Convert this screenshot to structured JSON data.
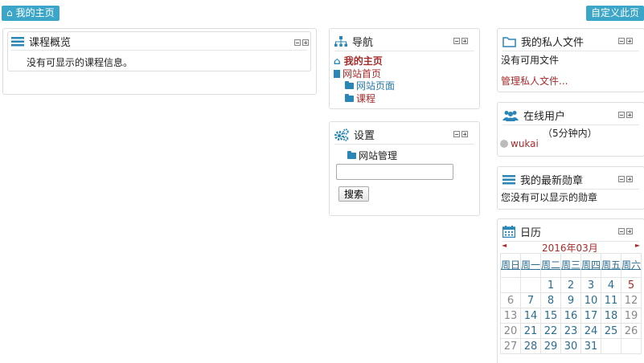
{
  "top": {
    "home_label": "我的主页",
    "customize_label": "自定义此页"
  },
  "course_overview": {
    "title": "课程概览",
    "empty_text": "没有可显示的课程信息。"
  },
  "navigation": {
    "title": "导航",
    "home": "我的主页",
    "site_home": "网站首页",
    "site_pages": "网站页面",
    "courses": "课程"
  },
  "settings": {
    "title": "设置",
    "site_admin": "网站管理",
    "search_button": "搜索",
    "search_value": ""
  },
  "private_files": {
    "title": "我的私人文件",
    "empty_text": "没有可用文件",
    "manage_link": "管理私人文件..."
  },
  "online_users": {
    "title": "在线用户",
    "period": "（5分钟内）",
    "users": [
      "wukai"
    ]
  },
  "badges": {
    "title": "我的最新勋章",
    "empty_text": "您没有可以显示的勋章"
  },
  "calendar": {
    "title": "日历",
    "month": "2016年03月",
    "prev": "◄",
    "next": "►",
    "weekdays": [
      "周日",
      "周一",
      "周二",
      "周三",
      "周四",
      "周五",
      "周六"
    ],
    "weeks": [
      [
        "",
        "",
        "1",
        "2",
        "3",
        "4",
        "5"
      ],
      [
        "6",
        "7",
        "8",
        "9",
        "10",
        "11",
        "12"
      ],
      [
        "13",
        "14",
        "15",
        "16",
        "17",
        "18",
        "19"
      ],
      [
        "20",
        "21",
        "22",
        "23",
        "24",
        "25",
        "26"
      ],
      [
        "27",
        "28",
        "29",
        "30",
        "31",
        "",
        ""
      ]
    ]
  }
}
